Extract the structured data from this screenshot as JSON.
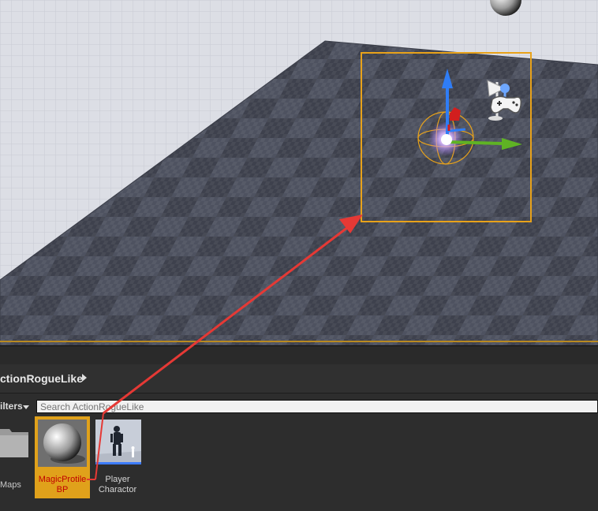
{
  "content_browser": {
    "path": "ctionRogueLike",
    "filters_label": "ilters",
    "search": {
      "placeholder": "Search ActionRogueLike",
      "value": ""
    },
    "folders": [
      {
        "label": "Maps",
        "icon": "folder-icon"
      }
    ],
    "assets": [
      {
        "name": "MagicProtile\nBP",
        "selected": true,
        "thumbnail": "sphere"
      },
      {
        "name": "Player\nCharactor",
        "selected": false,
        "thumbnail": "character"
      }
    ]
  },
  "viewport": {
    "floor": "checker-grid",
    "gizmo_axes": [
      "x-axis-green",
      "z-axis-blue",
      "y-axis-red"
    ],
    "selection_color": "#e8a21a",
    "icons": [
      "player-start-icon",
      "gamepad-icon",
      "light-sphere-icon"
    ]
  },
  "annotation": {
    "arrow_color": "#e53935"
  },
  "colors": {
    "selection": "#e0a11b",
    "asset_label_selected": "#c00000",
    "arrow": "#e53935"
  }
}
